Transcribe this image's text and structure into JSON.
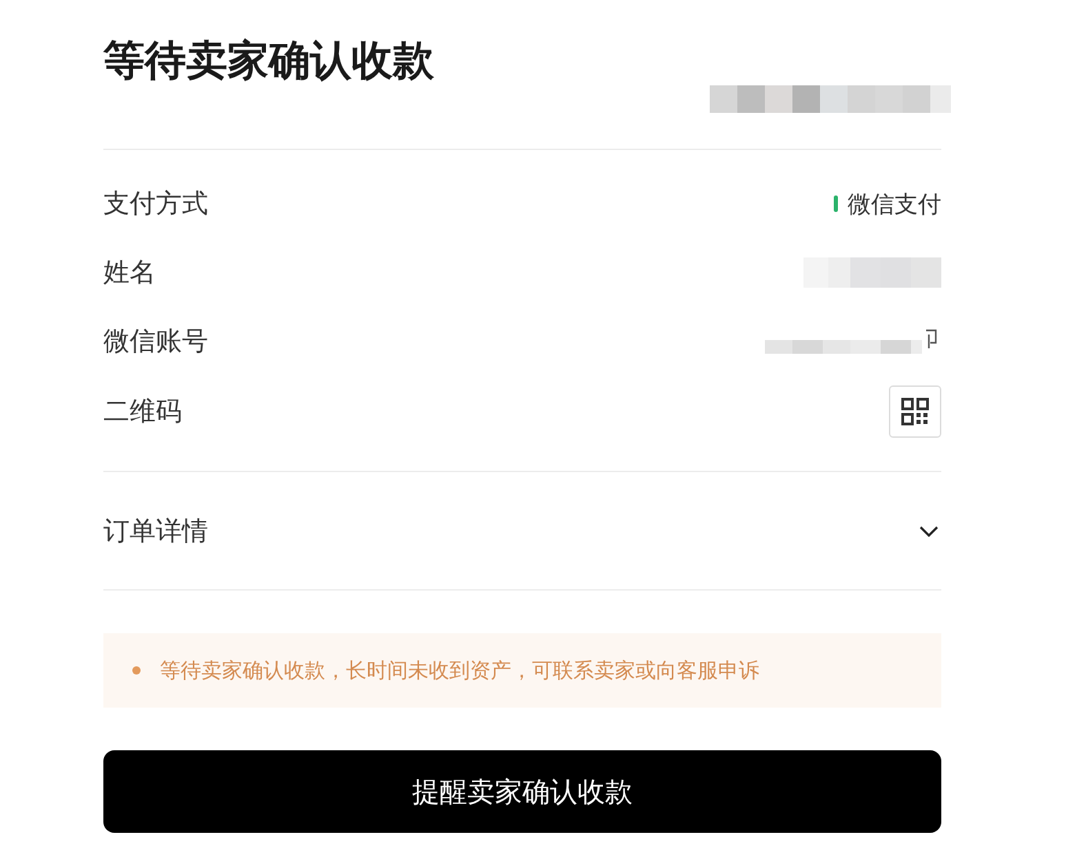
{
  "header": {
    "title": "等待卖家确认收款",
    "aside_redacted": true
  },
  "payment_rows": [
    {
      "label": "支付方式",
      "kind": "method",
      "value": "微信支付"
    },
    {
      "label": "姓名",
      "kind": "redacted"
    },
    {
      "label": "微信账号",
      "kind": "redacted_account"
    },
    {
      "label": "二维码",
      "kind": "qr"
    }
  ],
  "order_details": {
    "label": "订单详情",
    "expanded": false
  },
  "notice": {
    "text": "等待卖家确认收款，长时间未收到资产，可联系卖家或向客服申诉"
  },
  "primary_button": {
    "label": "提醒卖家确认收款"
  }
}
